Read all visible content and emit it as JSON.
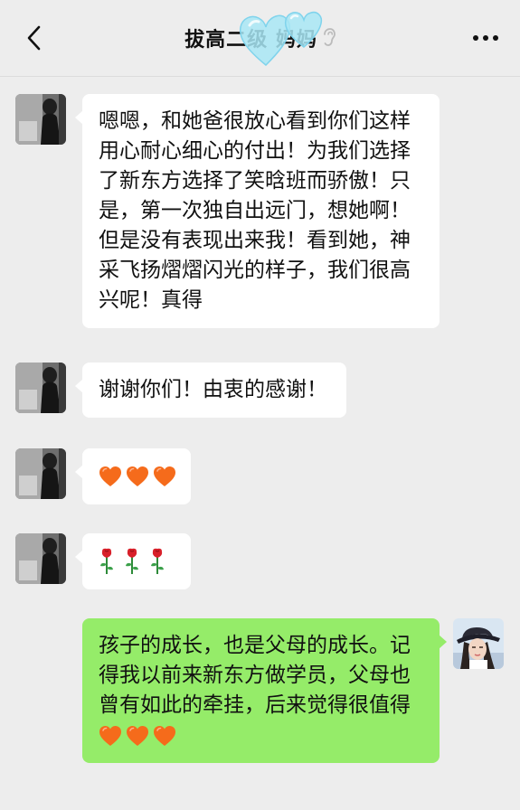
{
  "header": {
    "title": "拔高二级   妈妈"
  },
  "messages": [
    {
      "side": "in",
      "text": "嗯嗯，和她爸很放心看到你们这样用心耐心细心的付出！为我们选择了新东方选择了笑晗班而骄傲！只是，第一次独自出远门，想她啊！但是没有表现出来我！看到她，神采飞扬熠熠闪光的样子，我们很高兴呢！真得"
    },
    {
      "side": "in",
      "text": "谢谢你们！由衷的感谢！"
    },
    {
      "side": "in",
      "emoji": [
        "orange-heart-icon",
        "orange-heart-icon",
        "orange-heart-icon"
      ]
    },
    {
      "side": "in",
      "emoji": [
        "rose-icon",
        "rose-icon",
        "rose-icon"
      ]
    },
    {
      "side": "out",
      "text": "孩子的成长，也是父母的成长。记得我以前来新东方做学员，父母也曾有如此的牵挂，后来觉得很值得",
      "emoji": [
        "orange-heart-icon",
        "orange-heart-icon",
        "orange-heart-icon"
      ]
    }
  ],
  "colors": {
    "background": "#EDEDED",
    "incoming_bubble": "#FFFFFF",
    "outgoing_bubble": "#95EC69",
    "heart": "#F56B1B",
    "decor_hearts": "#A8E6F5"
  }
}
